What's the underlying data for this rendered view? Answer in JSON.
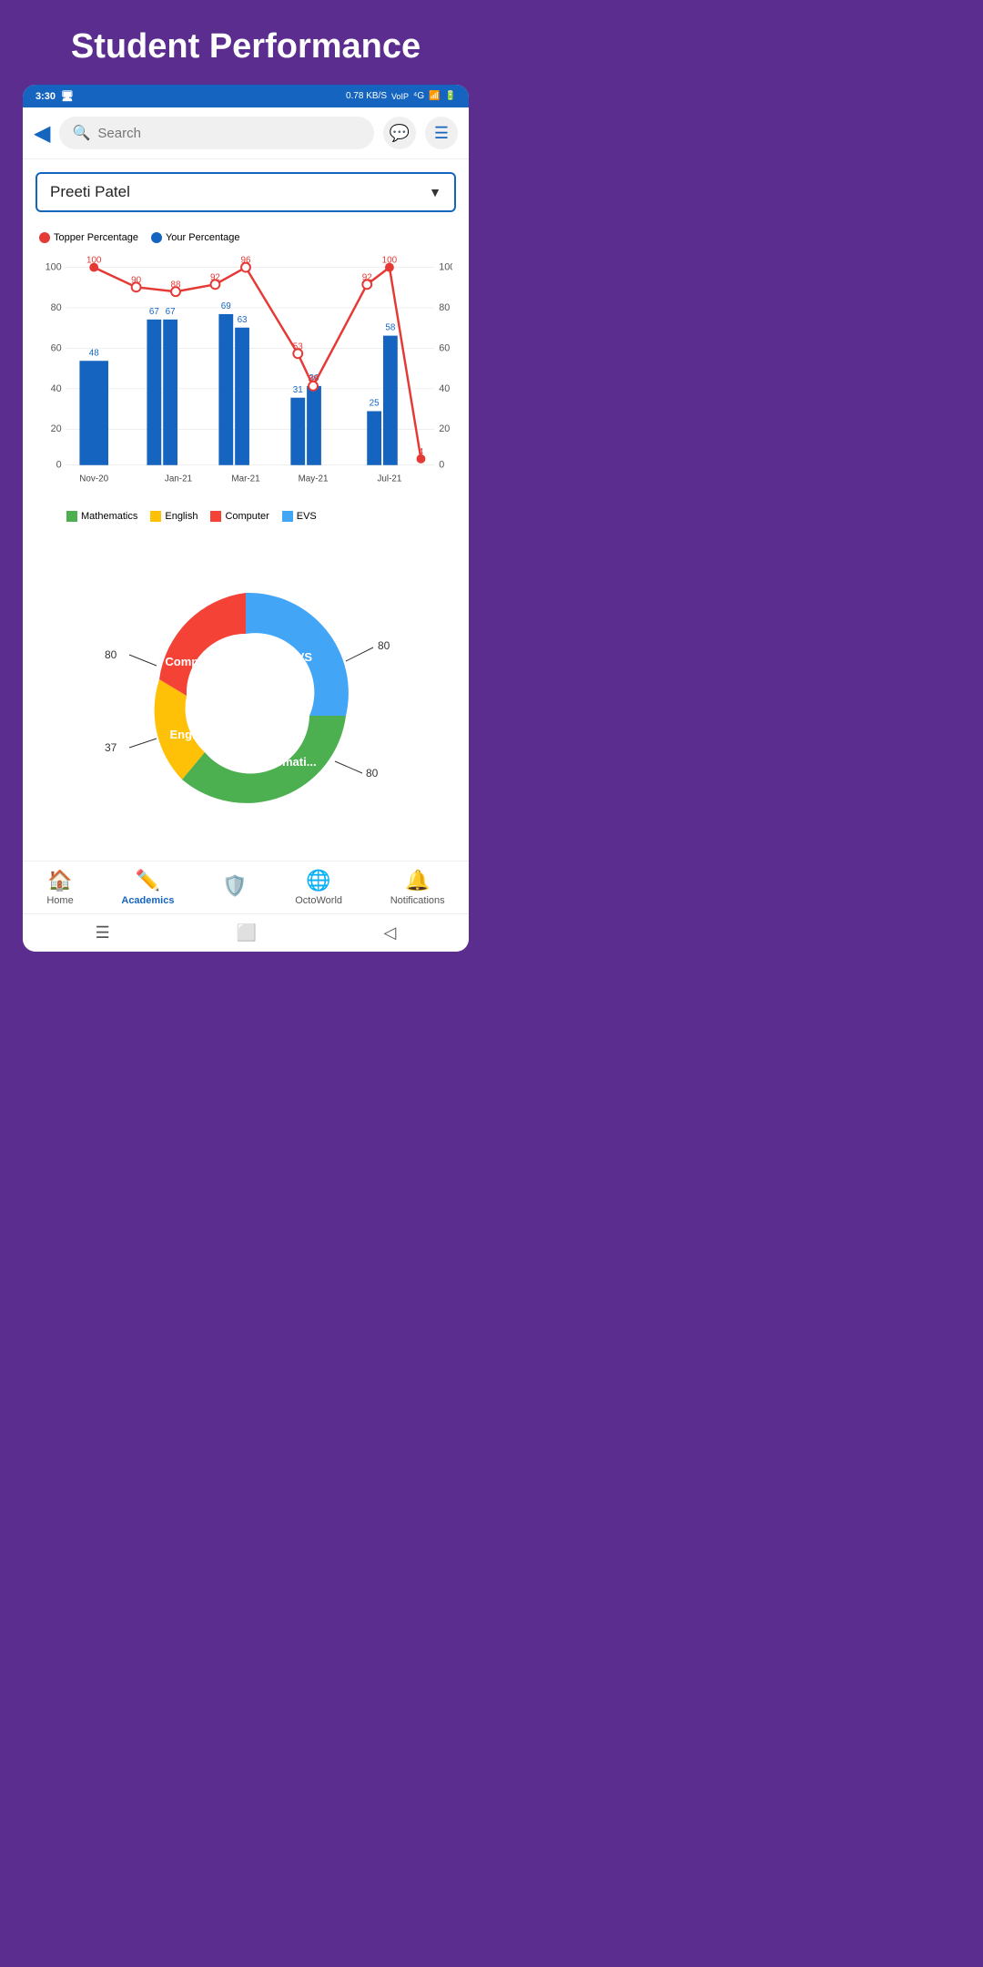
{
  "page": {
    "title": "Student Performance"
  },
  "statusBar": {
    "time": "3:30",
    "network": "0.78 KB/S",
    "type": "4G"
  },
  "topBar": {
    "searchPlaceholder": "Search",
    "chatIcon": "💬",
    "menuIcon": "☰"
  },
  "dropdown": {
    "selectedStudent": "Preeti Patel",
    "arrow": "▼"
  },
  "chart": {
    "legend": {
      "topperLabel": "Topper Percentage",
      "yourLabel": "Your Percentage"
    },
    "months": [
      "Nov-20",
      "Jan-21",
      "Mar-21",
      "May-21",
      "Jul-21"
    ],
    "topperData": [
      100,
      90,
      88,
      92,
      96,
      53,
      38,
      92,
      100,
      4
    ],
    "yourData": [
      48,
      67,
      67,
      69,
      63,
      31,
      36,
      25,
      58,
      4
    ],
    "subjectLegend": [
      "Mathematics",
      "English",
      "Computer",
      "EVS"
    ],
    "subjectColors": [
      "#4caf50",
      "#ffc107",
      "#f44336",
      "#42a5f5"
    ]
  },
  "donut": {
    "segments": [
      {
        "label": "EVS",
        "value": 80,
        "color": "#42a5f5",
        "textColor": "white"
      },
      {
        "label": "Mathematics",
        "value": 80,
        "color": "#4caf50",
        "textColor": "white"
      },
      {
        "label": "English",
        "value": 37,
        "color": "#ffc107",
        "textColor": "white"
      },
      {
        "label": "Computer",
        "value": 80,
        "color": "#f44336",
        "textColor": "white"
      }
    ],
    "annotations": [
      {
        "label": "80",
        "side": "right"
      },
      {
        "label": "80",
        "side": "left"
      },
      {
        "label": "37",
        "side": "left"
      },
      {
        "label": "80",
        "side": "right"
      }
    ]
  },
  "bottomNav": {
    "items": [
      {
        "label": "Home",
        "icon": "🏠",
        "active": false
      },
      {
        "label": "Academics",
        "icon": "✏️",
        "active": true
      },
      {
        "label": "",
        "icon": "🛡️",
        "active": false,
        "special": true
      },
      {
        "label": "OctoWorld",
        "icon": "🌐",
        "active": false
      },
      {
        "label": "Notifications",
        "icon": "🔔",
        "active": false
      }
    ]
  }
}
